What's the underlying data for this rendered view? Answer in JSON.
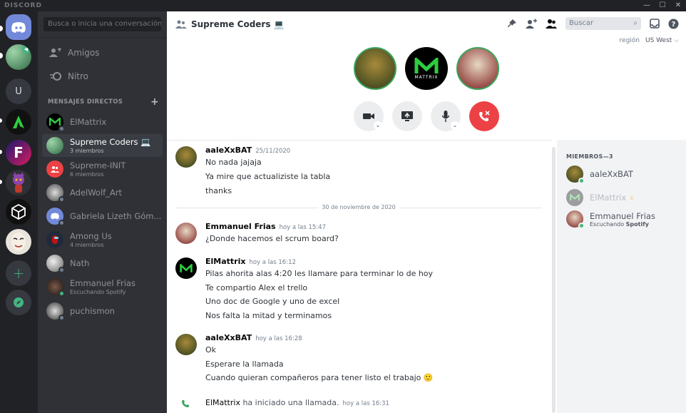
{
  "app": {
    "brand": "DISCORD",
    "window_controls": [
      "—",
      "☐",
      "✕"
    ]
  },
  "guilds": [
    {
      "name": "home",
      "color": "#7289da"
    },
    {
      "name": "voice-server",
      "color": "#4a8b5e"
    },
    {
      "name": "U",
      "label": "U",
      "color": "#36393f"
    },
    {
      "name": "green-server",
      "color": "#111111"
    },
    {
      "name": "f-server",
      "color": "#1a1a6e"
    },
    {
      "name": "purple-server",
      "color": "#5c3b75"
    },
    {
      "name": "unity-server",
      "color": "#111111"
    },
    {
      "name": "mask-server",
      "color": "#e8e4dc"
    },
    {
      "name": "add-server",
      "label": "+"
    },
    {
      "name": "explore",
      "label": ""
    }
  ],
  "dm_search": {
    "placeholder": "Busca o inicia una conversación"
  },
  "nav": {
    "friends": "Amigos",
    "nitro": "Nitro"
  },
  "dm_header": "MENSAJES DIRECTOS",
  "dms": [
    {
      "name": "ElMattrix",
      "sub": ""
    },
    {
      "name": "Supreme Coders 💻",
      "sub": "3 miembros"
    },
    {
      "name": "Supreme-INIT",
      "sub": "6 miembros"
    },
    {
      "name": "AdelWolf_Art",
      "sub": ""
    },
    {
      "name": "Gabriela Lizeth Góm...",
      "sub": ""
    },
    {
      "name": "Among Us",
      "sub": "4 miembros"
    },
    {
      "name": "Nath",
      "sub": ""
    },
    {
      "name": "Emmanuel Frias",
      "sub": "Escuchando Spotify"
    },
    {
      "name": "puchismon",
      "sub": ""
    }
  ],
  "header": {
    "title": "Supreme Coders 💻",
    "search_placeholder": "Buscar",
    "region_label": "región",
    "region_value": "US West"
  },
  "messages": [
    {
      "author": "aaleXxBAT",
      "time": "25/11/2020",
      "lines": [
        "No nada jajaja",
        "Ya mire que actualiziste la tabla",
        "thanks"
      ]
    },
    {
      "divider": "30 de noviembre de 2020"
    },
    {
      "author": "Emmanuel Frias",
      "time": "hoy a las 15:47",
      "lines": [
        "¿Donde hacemos el scrum board?"
      ]
    },
    {
      "author": "ElMattrix",
      "time": "hoy a las 16:12",
      "lines": [
        "Pilas ahorita alas 4:20 les llamare para terminar lo de hoy",
        "Te compartio Alex el trello",
        "Uno doc de Google y uno de excel",
        "Nos falta la mitad y terminamos"
      ]
    },
    {
      "author": "aaleXxBAT",
      "time": "hoy a las 16:28",
      "lines": [
        "Ok",
        "Esperare la llamada",
        "Cuando quieran compañeros para tener listo el trabajo 🙂"
      ]
    },
    {
      "system_author": "ElMattrix",
      "system_text": " ha iniciado una llamada.",
      "time": "hoy a las 16:31"
    }
  ],
  "members": {
    "header": "MIEMBROS—3",
    "list": [
      {
        "name": "aaleXxBAT",
        "sub": ""
      },
      {
        "name": "ElMattrix",
        "sub": ""
      },
      {
        "name": "Emmanuel Frias",
        "sub_prefix": "Escuchando ",
        "sub_bold": "Spotify"
      }
    ]
  },
  "colors": {
    "blurple": "#7289da",
    "online": "#43b581",
    "hangup": "#ed4245",
    "call_ring": "#3ba55d"
  }
}
